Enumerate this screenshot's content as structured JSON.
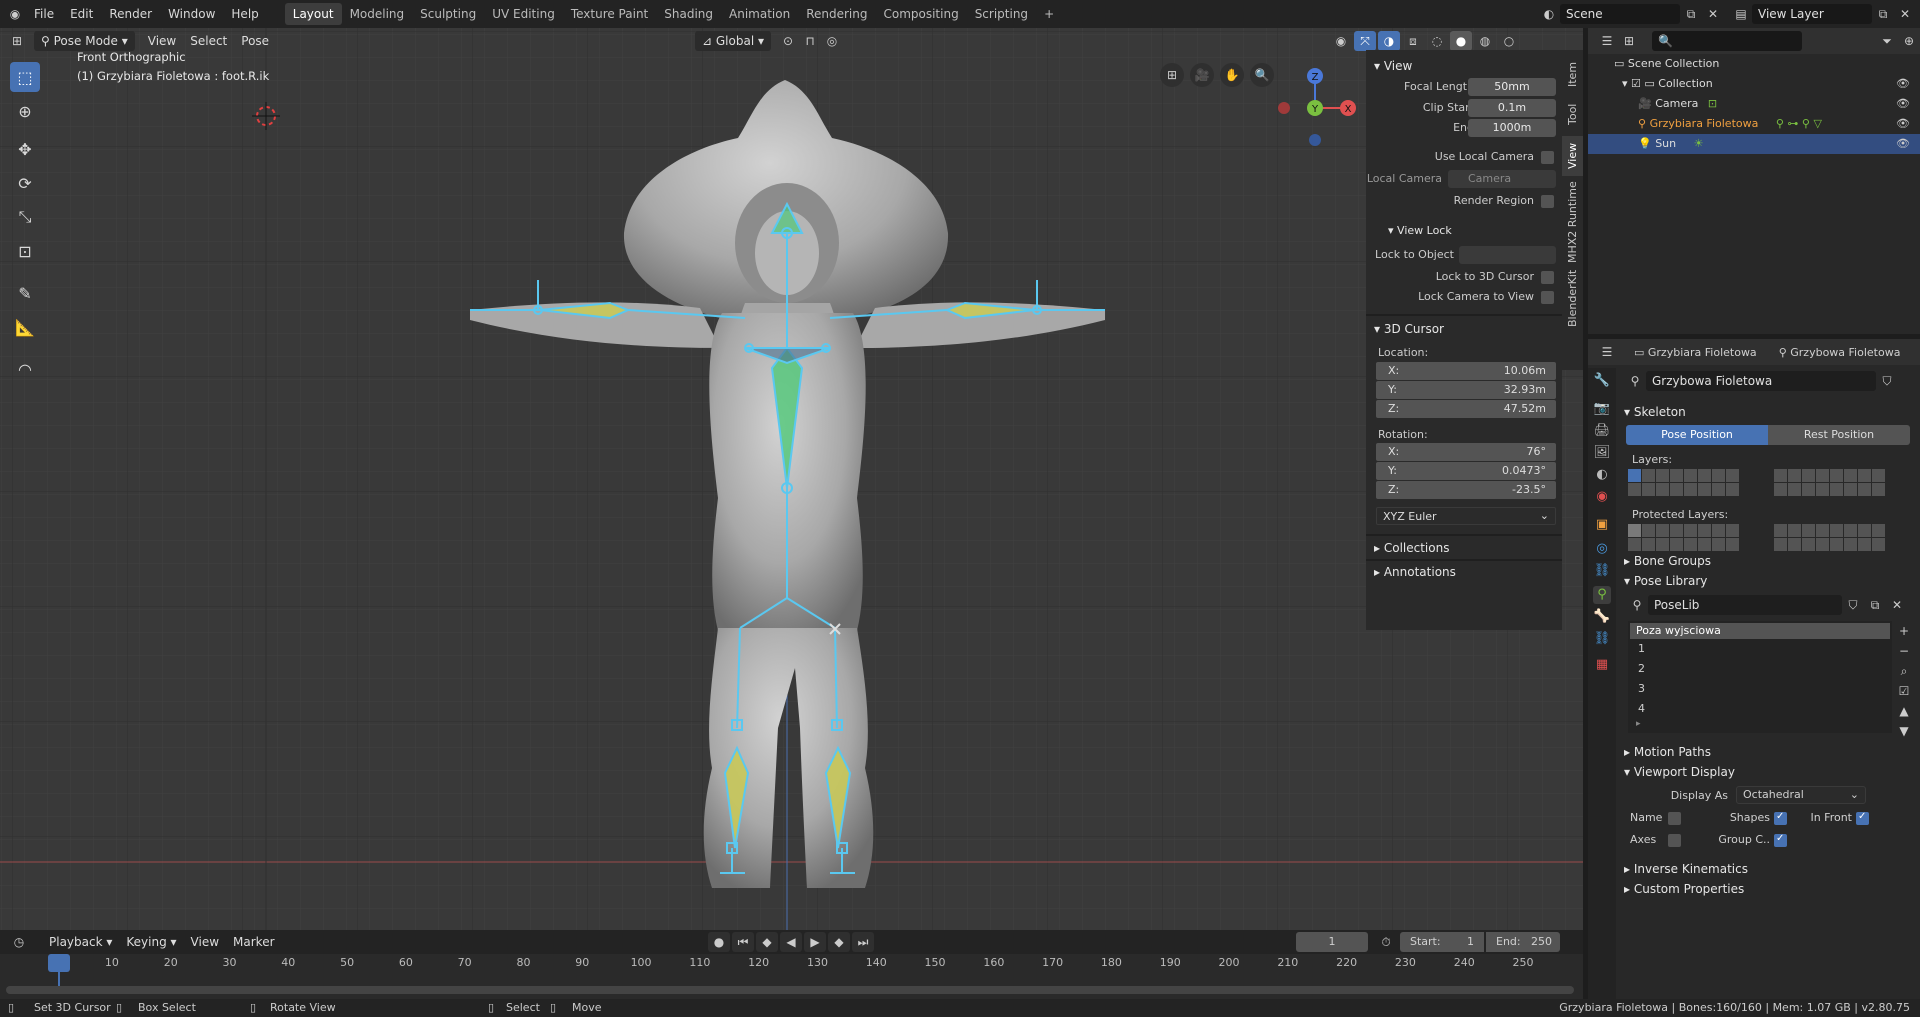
{
  "topbar": {
    "menu": [
      "File",
      "Edit",
      "Render",
      "Window",
      "Help"
    ],
    "workspaces": [
      "Layout",
      "Modeling",
      "Sculpting",
      "UV Editing",
      "Texture Paint",
      "Shading",
      "Animation",
      "Rendering",
      "Compositing",
      "Scripting"
    ],
    "active_workspace": "Layout",
    "add_workspace": "+",
    "scene": "Scene",
    "view_layer": "View Layer"
  },
  "viewport": {
    "mode": "Pose Mode",
    "menus": [
      "View",
      "Select",
      "Pose"
    ],
    "orientation": "Global",
    "overlay_title": "Front Orthographic",
    "overlay_subtitle": "(1) Grzybiara Fioletowa : foot.R.ik",
    "gizmo_axes": [
      "Z",
      "Y",
      "X"
    ]
  },
  "npanel": {
    "tabs": [
      "Item",
      "Tool",
      "View",
      "MHX2 Runtime",
      "BlenderKit"
    ],
    "active_tab": "View",
    "view_section": "View",
    "focal_length_label": "Focal Length",
    "focal_length": "50mm",
    "clip_start_label": "Clip Start",
    "clip_start": "0.1m",
    "end_label": "End",
    "clip_end": "1000m",
    "use_local_camera": "Use Local Camera",
    "local_camera_label": "Local Camera",
    "local_camera": "Camera",
    "render_region": "Render Region",
    "view_lock": "View Lock",
    "lock_to_object": "Lock to Object",
    "lock_to_3d_cursor": "Lock to 3D Cursor",
    "lock_camera_to_view": "Lock Camera to View",
    "cursor_section": "3D Cursor",
    "location_label": "Location:",
    "loc_x": "10.06m",
    "loc_y": "32.93m",
    "loc_z": "47.52m",
    "rotation_label": "Rotation:",
    "rot_x": "76°",
    "rot_y": "0.0473°",
    "rot_z": "-23.5°",
    "rotation_mode": "XYZ Euler",
    "collections": "Collections",
    "annotations": "Annotations",
    "axis_x": "X:",
    "axis_y": "Y:",
    "axis_z": "Z:"
  },
  "outliner": {
    "scene_collection": "Scene Collection",
    "collection": "Collection",
    "items": [
      "Camera",
      "Grzybiara Fioletowa",
      "Sun"
    ]
  },
  "properties": {
    "object_name": "Grzybiara Fioletowa",
    "armature_name": "Grzybowa Fioletowa",
    "data_name": "Grzybowa Fioletowa",
    "skeleton": "Skeleton",
    "pose_position": "Pose Position",
    "rest_position": "Rest Position",
    "layers": "Layers:",
    "protected_layers": "Protected Layers:",
    "bone_groups": "Bone Groups",
    "pose_library": "Pose Library",
    "poselib": "PoseLib",
    "poses": [
      "Poza wyjsciowa",
      "1",
      "2",
      "3",
      "4"
    ],
    "motion_paths": "Motion Paths",
    "viewport_display": "Viewport Display",
    "display_as_label": "Display As",
    "display_as": "Octahedral",
    "name_label": "Name",
    "shapes_label": "Shapes",
    "in_front_label": "In Front",
    "axes_label": "Axes",
    "group_c_label": "Group C..",
    "inverse_kinematics": "Inverse Kinematics",
    "custom_properties": "Custom Properties"
  },
  "timeline": {
    "menus": [
      "Playback",
      "Keying",
      "View",
      "Marker"
    ],
    "current_frame": "1",
    "start_label": "Start:",
    "start": "1",
    "end_label": "End:",
    "end": "250",
    "ticks": [
      "1",
      "10",
      "20",
      "30",
      "40",
      "50",
      "60",
      "70",
      "80",
      "90",
      "100",
      "110",
      "120",
      "130",
      "140",
      "150",
      "160",
      "170",
      "180",
      "190",
      "200",
      "210",
      "220",
      "230",
      "240",
      "250"
    ]
  },
  "statusbar": {
    "left": [
      "Set 3D Cursor",
      "Box Select",
      "Rotate View",
      "Select",
      "Move"
    ],
    "right": "Grzybiara Fioletowa | Bones:160/160 | Mem: 1.07 GB | v2.80.75"
  },
  "colors": {
    "accent": "#4772b3",
    "bone_outline": "#5ac8f0",
    "bone_fill_yellow": "#c8c85a",
    "bone_fill_green": "#50c878",
    "selected_text": "#f0a040"
  }
}
